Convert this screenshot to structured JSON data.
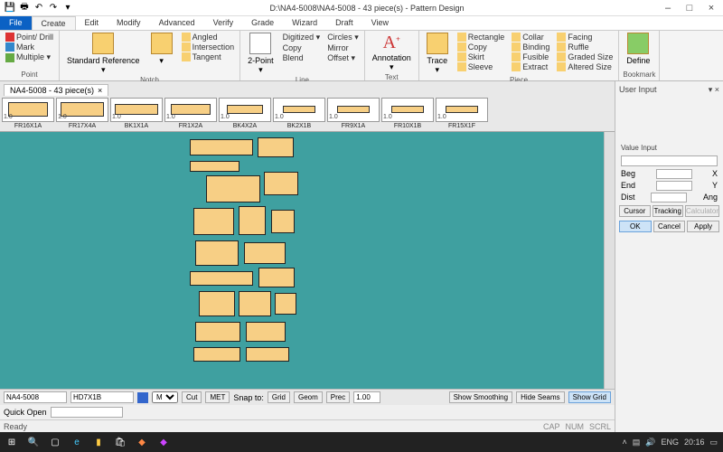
{
  "title": "D:\\NA4-5008\\NA4-5008  -  43 piece(s)  -  Pattern Design",
  "winbtns": {
    "min": "–",
    "max": "□",
    "close": "×"
  },
  "menutabs": [
    "File",
    "Create",
    "Edit",
    "Modify",
    "Advanced",
    "Verify",
    "Grade",
    "Wizard",
    "Draft",
    "View"
  ],
  "activeTab": 1,
  "ribbon": {
    "point": {
      "label": "Point",
      "items": [
        "Point/ Drill",
        "Mark",
        "Multiple ▾"
      ]
    },
    "notch": {
      "label": "Notch",
      "big": "Standard Reference",
      "items": [
        "Angled",
        "Intersection",
        "Tangent"
      ]
    },
    "line": {
      "label": "Line",
      "big": "2-Point",
      "col1": [
        "Digitized ▾",
        "Copy",
        "Blend"
      ],
      "col2": [
        "Circles ▾",
        "Mirror",
        "Offset ▾"
      ]
    },
    "text": {
      "label": "Text",
      "big": "Annotation"
    },
    "piece": {
      "label": "Piece",
      "big": "Trace",
      "col1": [
        "Rectangle",
        "Copy",
        "Skirt",
        "Sleeve"
      ],
      "col2": [
        "Collar",
        "Binding",
        "Fusible",
        "Extract"
      ],
      "col3": [
        "Facing",
        "Ruffle",
        "Graded Size",
        "Altered Size"
      ]
    },
    "bookmark": {
      "label": "Bookmark",
      "big": "Define"
    }
  },
  "doctab": {
    "name": "NA4-5008  -  43 piece(s)",
    "close": "×"
  },
  "thumbs": [
    "FR16X1A",
    "FR17X4A",
    "BK1X1A",
    "FR1X2A",
    "BK4X2A",
    "BK2X1B",
    "FR9X1A",
    "FR10X1B",
    "FR15X1F"
  ],
  "statusbar": {
    "style": "NA4-5008",
    "piece": "HD7X1B",
    "size": "M",
    "cut": "Cut",
    "met": "MET",
    "snap": "Snap to:",
    "grid": "Grid",
    "geom": "Geom",
    "prec": "Prec",
    "val": "1.00",
    "smooth": "Show Smoothing",
    "seams": "Hide Seams",
    "showgrid": "Show Grid"
  },
  "quick": {
    "lbl": "Quick Open"
  },
  "ready": "Ready",
  "tray": {
    "caps": "CAP",
    "num": "NUM",
    "scrl": "SCRL"
  },
  "userinput": {
    "title": "User Input",
    "value": "Value Input",
    "rows": [
      [
        "Beg",
        "X"
      ],
      [
        "End",
        "Y"
      ],
      [
        "Dist",
        "Ang"
      ]
    ],
    "mode": [
      "Cursor",
      "Tracking",
      "Calculator"
    ],
    "actions": [
      "OK",
      "Cancel",
      "Apply"
    ]
  },
  "taskbar": {
    "time": "20:16",
    "date": "",
    "lang": "ENG",
    "net": "◻"
  },
  "chart_data": null
}
